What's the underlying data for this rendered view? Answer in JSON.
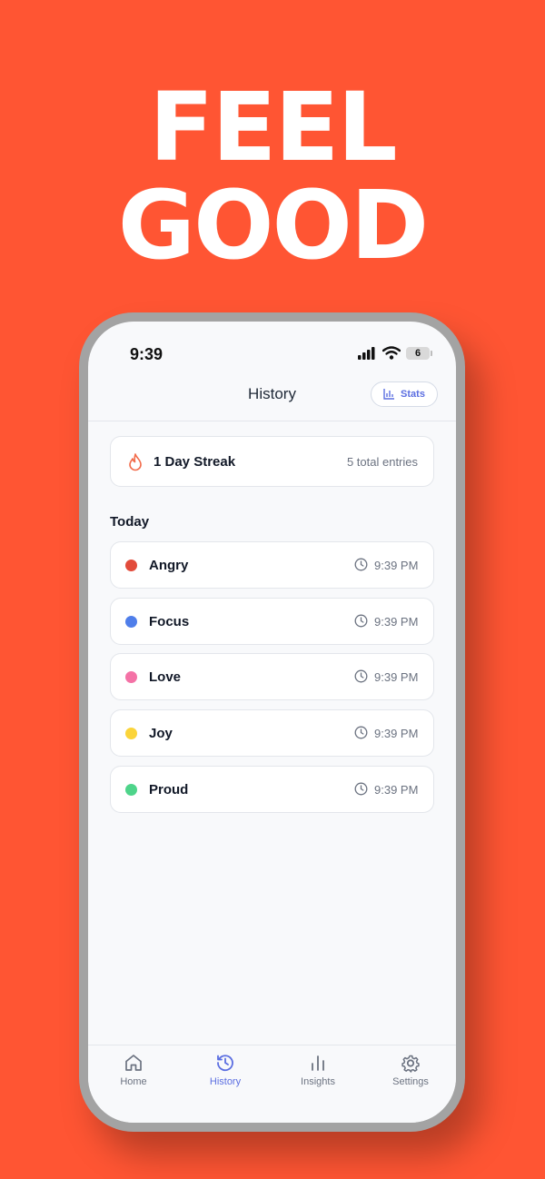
{
  "hero": {
    "line1": "FEEL",
    "line2": "GOOD"
  },
  "status_bar": {
    "time": "9:39",
    "battery": "6"
  },
  "header": {
    "title": "History",
    "stats_label": "Stats"
  },
  "streak": {
    "title": "1 Day Streak",
    "entries": "5 total entries"
  },
  "section_title": "Today",
  "entries": [
    {
      "name": "Angry",
      "time": "9:39 PM",
      "color": "#E24B3B"
    },
    {
      "name": "Focus",
      "time": "9:39 PM",
      "color": "#4F7EEA"
    },
    {
      "name": "Love",
      "time": "9:39 PM",
      "color": "#F472A6"
    },
    {
      "name": "Joy",
      "time": "9:39 PM",
      "color": "#FBD43A"
    },
    {
      "name": "Proud",
      "time": "9:39 PM",
      "color": "#4ED48A"
    }
  ],
  "tabs": [
    {
      "label": "Home",
      "icon": "home-icon",
      "active": false
    },
    {
      "label": "History",
      "icon": "history-icon",
      "active": true
    },
    {
      "label": "Insights",
      "icon": "bar-chart-icon",
      "active": false
    },
    {
      "label": "Settings",
      "icon": "gear-icon",
      "active": false
    }
  ],
  "colors": {
    "background": "#FF5533",
    "accent": "#5B6EE1",
    "flame": "#F26B4A"
  }
}
